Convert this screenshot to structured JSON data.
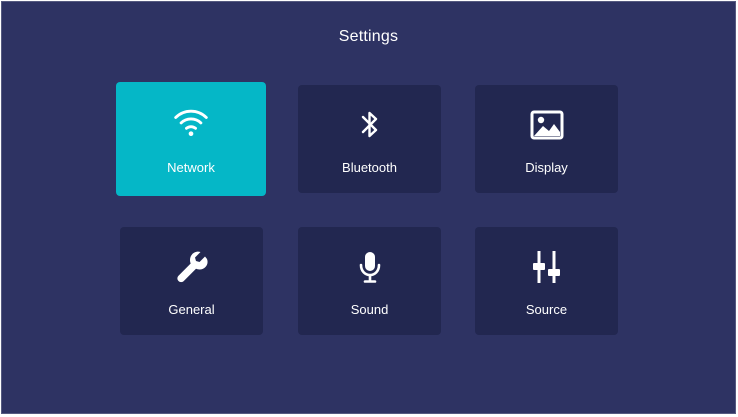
{
  "page": {
    "title": "Settings"
  },
  "colors": {
    "background": "#2e3363",
    "tile": "#222750",
    "selected_tile": "#05b7c7",
    "text": "#ffffff"
  },
  "tiles": [
    {
      "label": "Network",
      "icon": "wifi-icon",
      "selected": true
    },
    {
      "label": "Bluetooth",
      "icon": "bluetooth-icon",
      "selected": false
    },
    {
      "label": "Display",
      "icon": "image-icon",
      "selected": false
    },
    {
      "label": "General",
      "icon": "wrench-icon",
      "selected": false
    },
    {
      "label": "Sound",
      "icon": "microphone-icon",
      "selected": false
    },
    {
      "label": "Source",
      "icon": "sliders-icon",
      "selected": false
    }
  ]
}
